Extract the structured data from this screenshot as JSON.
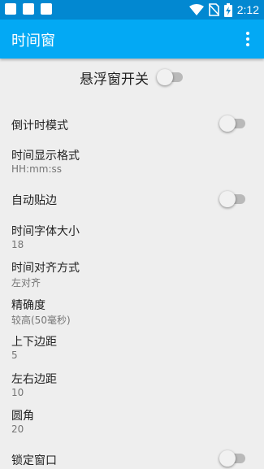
{
  "status_bar": {
    "time": "2:12",
    "icons": [
      "notification-square-icon",
      "notification-square-icon",
      "notification-square-icon",
      "wifi-icon",
      "no-sim-icon",
      "battery-charging-icon"
    ]
  },
  "app_bar": {
    "title": "时间窗",
    "menu_icon": "more-vert-icon"
  },
  "master_switch": {
    "label": "悬浮窗开关",
    "on": false
  },
  "settings": [
    {
      "id": "countdown",
      "title": "倒计时模式",
      "type": "switch",
      "on": false
    },
    {
      "id": "time-format",
      "title": "时间显示格式",
      "summary": "HH:mm:ss"
    },
    {
      "id": "auto-snap",
      "title": "自动贴边",
      "type": "switch",
      "on": false
    },
    {
      "id": "font-size",
      "title": "时间字体大小",
      "summary": "18"
    },
    {
      "id": "alignment",
      "title": "时间对齐方式",
      "summary": "左对齐"
    },
    {
      "id": "precision",
      "title": "精确度",
      "summary": "较高(50毫秒)"
    },
    {
      "id": "vertical-margin",
      "title": "上下边距",
      "summary": "5"
    },
    {
      "id": "horizontal-margin",
      "title": "左右边距",
      "summary": "10"
    },
    {
      "id": "corner-radius",
      "title": "圆角",
      "summary": "20"
    },
    {
      "id": "lock-window",
      "title": "锁定窗口",
      "type": "switch",
      "on": false
    }
  ],
  "colors": {
    "status_bar": "#0288d1",
    "app_bar": "#03a9f4",
    "background": "#eeeeee",
    "switch_track_off": "#b9b9b9",
    "switch_thumb_off": "#f1f1f1"
  }
}
